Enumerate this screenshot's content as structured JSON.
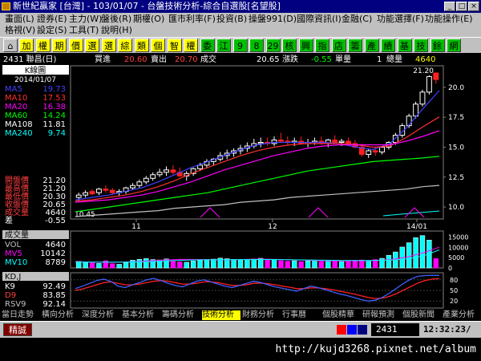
{
  "window": {
    "title": "新世紀贏家 [台灣] - 103/01/07 - 台盤技術分析-綜合自選股[名望股]",
    "controls": [
      "_",
      "□",
      "×"
    ]
  },
  "menu": {
    "row1": [
      "畫面(L)",
      "證券(E)",
      "主力(W)",
      "盤後(R)",
      "期權(O)",
      "匯市利率(F)",
      "投資(B)",
      "操盤991(D)",
      "國際資訊(I)",
      "金融(C)",
      "功能選擇(F)",
      "功能操作(E)"
    ],
    "row2": [
      "格視(V)",
      "設定(S)",
      "工具(T)",
      "說明(H)"
    ]
  },
  "toolbar": {
    "buttons": [
      "加",
      "權",
      "期",
      "價",
      "選",
      "選",
      "綜",
      "類",
      "個",
      "智",
      "權",
      "委",
      "江",
      "9",
      "8",
      "29",
      "核",
      "興",
      "指",
      "店",
      "籌",
      "產",
      "績",
      "基",
      "技",
      "餘",
      "網"
    ],
    "colors": {
      "green_face": "#00c000",
      "yellow_face": "#ffff00",
      "dark_face": "#008000"
    }
  },
  "quote": {
    "code_name": "2431 聯昌(日)",
    "bid_label": "買進",
    "bid": "20.60",
    "ask_label": "賣出",
    "ask": "20.70",
    "trade_label": "成交",
    "trade": "20.65",
    "change_label": "漲跌",
    "change": "-0.55",
    "volume_label": "單量",
    "volume": "1",
    "total_label": "總量",
    "total": "4640"
  },
  "kline": {
    "label": "K線圖",
    "date": "2014/01/07",
    "ma": [
      {
        "name": "MA5",
        "value": "19.73",
        "color": "#4040ff"
      },
      {
        "name": "MA10",
        "value": "17.53",
        "color": "#ff3030"
      },
      {
        "name": "MA20",
        "value": "16.38",
        "color": "#ff00ff"
      },
      {
        "name": "MA60",
        "value": "14.24",
        "color": "#00ff00"
      },
      {
        "name": "MA108",
        "value": "11.81",
        "color": "#ffffff"
      },
      {
        "name": "MA240",
        "value": "9.74",
        "color": "#00ffff"
      }
    ],
    "ohlc": [
      {
        "label": "開盤價",
        "value": "21.20"
      },
      {
        "label": "最高價",
        "value": "21.20"
      },
      {
        "label": "最低價",
        "value": "20.30"
      },
      {
        "label": "收盤價",
        "value": "20.65"
      },
      {
        "label": "成交量",
        "value": "4640"
      },
      {
        "label": "差",
        "value": "-0.55"
      }
    ],
    "y_ticks": [
      "20.0",
      "17.5",
      "15.0",
      "12.5",
      "10.0"
    ],
    "top_label": "21.20",
    "low_label": "10.45",
    "x_labels": [
      "11",
      "12",
      "14/01"
    ]
  },
  "volume": {
    "label": "成交量",
    "vol_label": "VOL",
    "vol": "4640",
    "mv5_label": "MV5",
    "mv5": "10142",
    "mv10_label": "MV10",
    "mv10": "8789",
    "ticks": [
      "15000",
      "10000",
      "5000",
      "0"
    ]
  },
  "kd": {
    "label": "KD,J",
    "k_label": "K9",
    "k": "92.49",
    "d_label": "D9",
    "d": "83.85",
    "rsv_label": "RSV9",
    "rsv": "92.14",
    "ticks": [
      "80",
      "50",
      "20"
    ]
  },
  "bottom_tabs": [
    "當日走勢",
    "橫向分析",
    "深度分析",
    "基本分析",
    "籌碼分析",
    "技術分析",
    "財務分析",
    "行事曆",
    "個股精華",
    "研報預測",
    "個股新聞",
    "產業分析"
  ],
  "status": {
    "left": "精誠",
    "code": "2431",
    "time": "12:32:23/"
  },
  "url": "http://kujd3268.pixnet.net/album"
}
